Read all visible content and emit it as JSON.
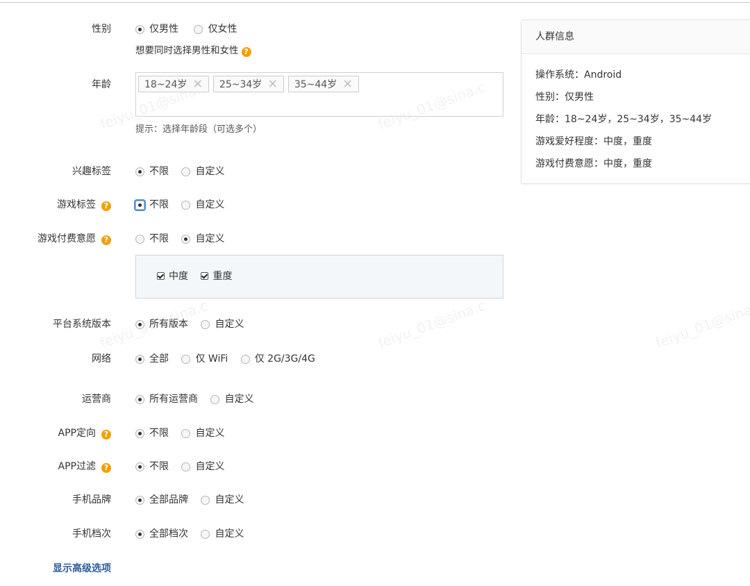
{
  "gender": {
    "label": "性别",
    "options": [
      "仅男性",
      "仅女性"
    ],
    "selected": "仅男性",
    "hint": "想要同时选择男性和女性"
  },
  "age": {
    "label": "年龄",
    "tags": [
      "18~24岁",
      "25~34岁",
      "35~44岁"
    ],
    "hint": "提示：选择年龄段（可选多个）"
  },
  "interest_tags": {
    "label": "兴趣标签",
    "options": [
      "不限",
      "自定义"
    ],
    "selected": "不限"
  },
  "game_tags": {
    "label": "游戏标签",
    "options": [
      "不限",
      "自定义"
    ],
    "selected": "不限"
  },
  "game_pay": {
    "label": "游戏付费意愿",
    "options": [
      "不限",
      "自定义"
    ],
    "selected": "自定义",
    "custom_choices": [
      "中度",
      "重度"
    ]
  },
  "platform_version": {
    "label": "平台系统版本",
    "options": [
      "所有版本",
      "自定义"
    ],
    "selected": "所有版本"
  },
  "network": {
    "label": "网络",
    "options": [
      "全部",
      "仅 WiFi",
      "仅 2G/3G/4G"
    ],
    "selected": "全部"
  },
  "carrier": {
    "label": "运营商",
    "options": [
      "所有运营商",
      "自定义"
    ],
    "selected": "所有运营商"
  },
  "app_targeting": {
    "label": "APP定向",
    "options": [
      "不限",
      "自定义"
    ],
    "selected": "不限"
  },
  "app_filter": {
    "label": "APP过滤",
    "options": [
      "不限",
      "自定义"
    ],
    "selected": "不限"
  },
  "phone_brand": {
    "label": "手机品牌",
    "options": [
      "全部品牌",
      "自定义"
    ],
    "selected": "全部品牌"
  },
  "phone_tier": {
    "label": "手机档次",
    "options": [
      "全部档次",
      "自定义"
    ],
    "selected": "全部档次"
  },
  "show_advanced": "显示高级选项",
  "help_glyph": "?",
  "remove_glyph": "×",
  "audience_info": {
    "title": "人群信息",
    "rows": [
      "操作系统：Android",
      "性别：仅男性",
      "年龄：18~24岁，25~34岁，35~44岁",
      "游戏爱好程度：中度，重度",
      "游戏付费意愿：中度，重度"
    ]
  },
  "watermark": "feiyu_01@sina.c",
  "colors": {
    "help_badge": "#f0a000",
    "link": "#2d5c9a",
    "focus": "#4a8fe0"
  }
}
